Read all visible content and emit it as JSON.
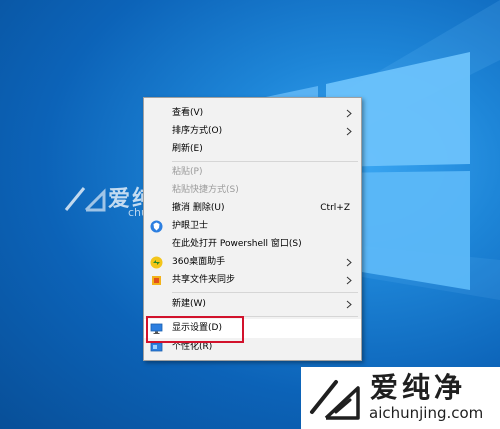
{
  "context_menu": {
    "items": [
      {
        "label": "查看(V)",
        "submenu": true,
        "disabled": false
      },
      {
        "label": "排序方式(O)",
        "submenu": true,
        "disabled": false
      },
      {
        "label": "刷新(E)",
        "submenu": false,
        "disabled": false
      },
      {
        "label": "粘贴(P)",
        "submenu": false,
        "disabled": true
      },
      {
        "label": "粘贴快捷方式(S)",
        "submenu": false,
        "disabled": true
      },
      {
        "label": "撤消 删除(U)",
        "shortcut": "Ctrl+Z",
        "submenu": false,
        "disabled": false
      },
      {
        "label": "护眼卫士",
        "icon": "shield-icon",
        "submenu": false,
        "disabled": false
      },
      {
        "label": "在此处打开 Powershell 窗口(S)",
        "submenu": false,
        "disabled": false
      },
      {
        "label": "360桌面助手",
        "icon": "desktop-assistant-icon",
        "submenu": true,
        "disabled": false
      },
      {
        "label": "共享文件夹同步",
        "icon": "folder-sync-icon",
        "submenu": true,
        "disabled": false
      },
      {
        "label": "新建(W)",
        "submenu": true,
        "disabled": false
      },
      {
        "label": "显示设置(D)",
        "icon": "display-settings-icon",
        "submenu": false,
        "disabled": false,
        "highlighted": true
      },
      {
        "label": "个性化(R)",
        "icon": "personalize-icon",
        "submenu": false,
        "disabled": false
      }
    ]
  },
  "watermark": {
    "title": "爱纯净",
    "url": "aichunjing.com",
    "mid_title": "爱纯净",
    "mid_url": "chunjing.com"
  },
  "colors": {
    "desktop": "#0c63b8",
    "menu_bg": "#f2f2f2",
    "highlight_border": "#d2122c"
  }
}
